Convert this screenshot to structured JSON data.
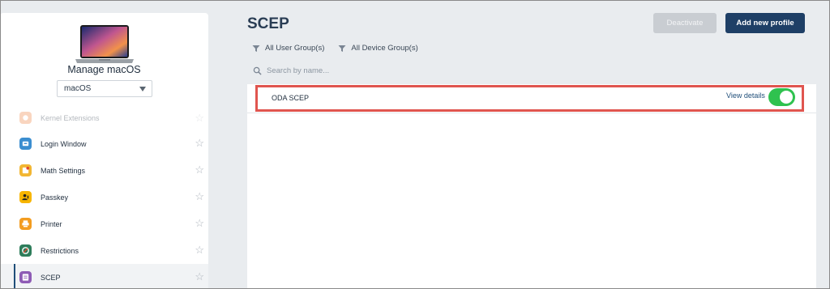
{
  "sidebar": {
    "title": "Manage macOS",
    "os_select": {
      "value": "macOS"
    },
    "items": [
      {
        "label": "Kernel Extensions",
        "icon": "kernel-extensions-icon",
        "color": "#f08a4b"
      },
      {
        "label": "Login Window",
        "icon": "login-window-icon",
        "color": "#3b8ed0"
      },
      {
        "label": "Math Settings",
        "icon": "math-settings-icon",
        "color": "#f2b632"
      },
      {
        "label": "Passkey",
        "icon": "passkey-icon",
        "color": "#f7b500"
      },
      {
        "label": "Printer",
        "icon": "printer-icon",
        "color": "#f39c1f"
      },
      {
        "label": "Restrictions",
        "icon": "restrictions-icon",
        "color": "#2e7d5b"
      },
      {
        "label": "SCEP",
        "icon": "scep-icon",
        "color": "#8e5bb5"
      }
    ]
  },
  "main": {
    "title": "SCEP",
    "deactivate_label": "Deactivate",
    "add_label": "Add new profile",
    "filters": [
      "All User Group(s)",
      "All Device Group(s)"
    ],
    "search": {
      "placeholder": "Search by name..."
    },
    "rows": [
      {
        "name": "ODA SCEP",
        "action": "View details",
        "enabled": true
      }
    ]
  },
  "colors": {
    "accent": "#1e3f66",
    "toggle_on": "#2fc24f",
    "highlight": "#e0554f"
  }
}
